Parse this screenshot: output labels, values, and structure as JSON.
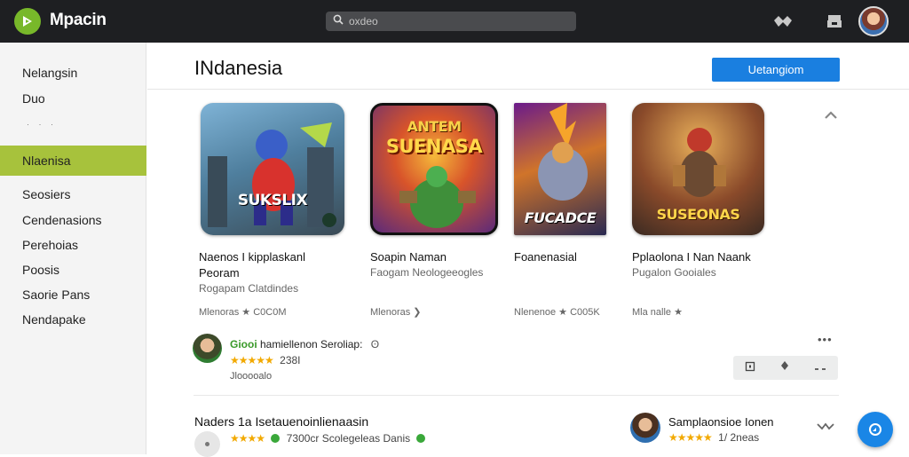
{
  "app": {
    "brand": "Mpacin"
  },
  "search": {
    "placeholder": "oxdeo"
  },
  "sidebar": {
    "items": [
      {
        "label": "Nelangsin"
      },
      {
        "label": "Duo"
      },
      {
        "label": "Nlaenisa"
      },
      {
        "label": "Seosiers"
      },
      {
        "label": "Cendenasions"
      },
      {
        "label": "Perehoias"
      },
      {
        "label": "Poosis"
      },
      {
        "label": "Saorie Pans"
      },
      {
        "label": "Nendapake"
      }
    ],
    "dots": "· · ·"
  },
  "main": {
    "title": "INdanesia",
    "header_button": "Uetangiom"
  },
  "apps": [
    {
      "art_text": "SUKSLIX",
      "name1": "Naenos I kipplaskanl",
      "name2": "Peoram",
      "sub": "Rogapam Clatdindes",
      "meta": "Mlenoras  ★ C0C0M"
    },
    {
      "art_text1": "ANTEM",
      "art_text2": "SUENASA",
      "name1": "Soapin Naman",
      "sub": "Faogam Neologeeogles",
      "meta": "Mlenoras  ❯"
    },
    {
      "art_text": "FUCADCE",
      "name1": "Foanenasial",
      "sub": "",
      "meta": "Nlenenoe  ★ C005K"
    },
    {
      "art_text": "SUSEONAS",
      "name1": "Pplaolona I Nan Naank",
      "sub": "Pugalon Gooiales",
      "meta": "Mla nalle  ★"
    }
  ],
  "reviews": [
    {
      "name_green": "Giooi",
      "name_rest": " hamiellenon Seroliap:",
      "mark": "ʘ",
      "rating": "★★★★★",
      "rating_value": "238I",
      "date": "Jlooooalo"
    },
    {
      "title": "Naders 1a Isetauenoinlienaasin",
      "rating": "★★★★",
      "text": "7300cr Scolegeleas Danis"
    },
    {
      "name": "Samplaonsioe Ionen",
      "rating": "★★★★★",
      "rating_value": "1/ 2neas"
    }
  ],
  "colors": {
    "accent": "#1a7fe0",
    "active_nav": "#a7c23c",
    "topbar": "#1e1f22",
    "star": "#f2a900"
  }
}
